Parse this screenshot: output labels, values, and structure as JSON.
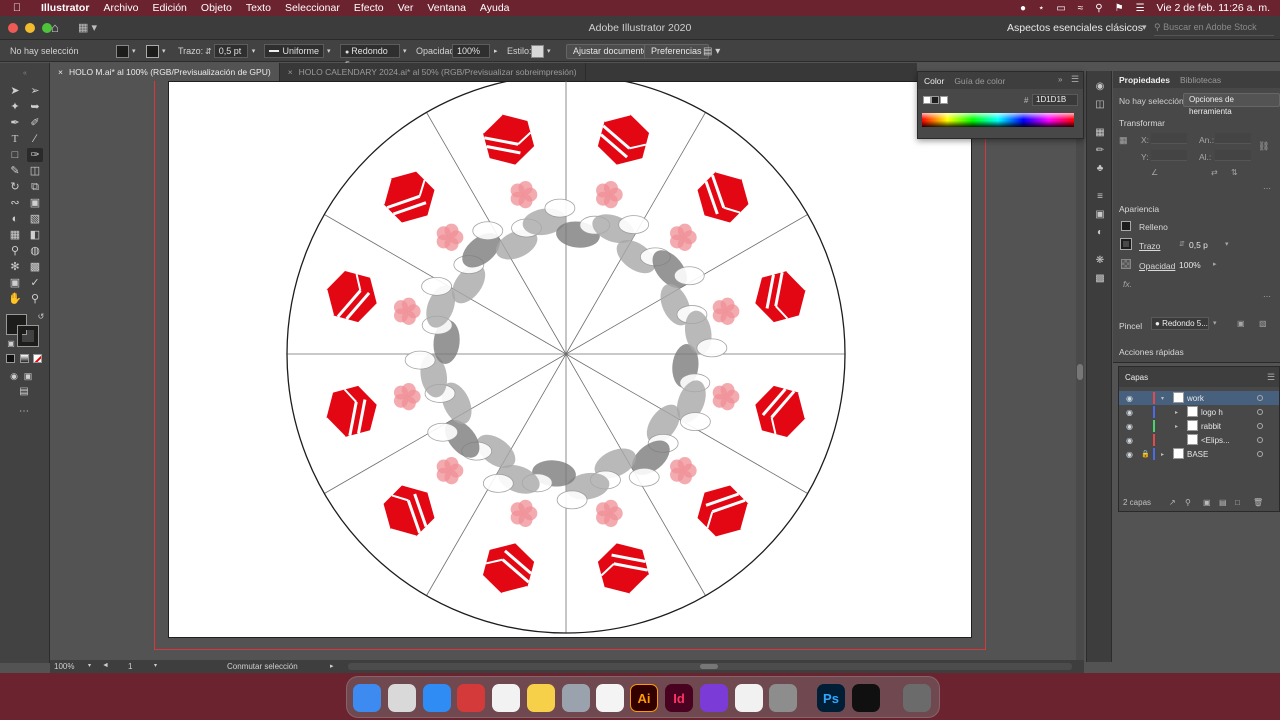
{
  "menubar": {
    "app_name": "Illustrator",
    "items": [
      "Archivo",
      "Edición",
      "Objeto",
      "Texto",
      "Seleccionar",
      "Efecto",
      "Ver",
      "Ventana",
      "Ayuda"
    ],
    "datetime": "Vie 2 de feb.  11:26 a. m."
  },
  "window": {
    "title": "Adobe Illustrator 2020",
    "workspace": "Aspectos esenciales clásicos",
    "stock_search_placeholder": "Buscar en Adobe Stock"
  },
  "control_bar": {
    "selection_status": "No hay selección",
    "stroke_label": "Trazo:",
    "stroke_weight": "0,5 pt",
    "stroke_profile": "Uniforme",
    "brush": "Redondo 5...",
    "opacity_label": "Opacidad:",
    "opacity_value": "100%",
    "style_label": "Estilo:",
    "doc_setup_button": "Ajustar documento",
    "preferences_button": "Preferencias"
  },
  "tabs": [
    {
      "label": "HOLO M.ai* al 100% (RGB/Previsualización de GPU)",
      "active": true
    },
    {
      "label": "HOLO CALENDARY 2024.ai* al 50% (RGB/Previsualizar sobreimpresión)",
      "active": false
    }
  ],
  "color_panel": {
    "tab_color": "Color",
    "tab_guide": "Guía de color",
    "hex_prefix": "#",
    "hex_value": "1D1D1B"
  },
  "properties_panel": {
    "tab_properties": "Propiedades",
    "tab_libraries": "Bibliotecas",
    "no_selection": "No hay selección",
    "tool_options_button": "Opciones de herramienta",
    "transform_title": "Transformar",
    "x_label": "X:",
    "y_label": "Y:",
    "w_label": "An.:",
    "h_label": "Al.:",
    "appearance_title": "Apariencia",
    "fill_label": "Relleno",
    "stroke_label": "Trazo",
    "stroke_value": "0,5 p",
    "opacity_label": "Opacidad",
    "opacity_value": "100%",
    "fx_label": "fx.",
    "brush_label": "Pincel",
    "brush_value": "Redondo 5...",
    "quick_actions": "Acciones rápidas"
  },
  "layers_panel": {
    "title": "Capas",
    "layers": [
      {
        "name": "work",
        "color": "#e34b4b",
        "selected": true,
        "indent": 0
      },
      {
        "name": "logo h",
        "color": "#4b6be3",
        "selected": false,
        "indent": 1
      },
      {
        "name": "rabbit",
        "color": "#4bd36b",
        "selected": false,
        "indent": 1
      },
      {
        "name": "<Elips...",
        "color": "#e34b4b",
        "selected": false,
        "indent": 1
      },
      {
        "name": "BASE",
        "color": "#4b6be3",
        "selected": false,
        "indent": 0
      }
    ],
    "count": "2 capas"
  },
  "status_bar": {
    "zoom": "100%",
    "artboard": "1",
    "tool_status": "Conmutar selección"
  },
  "colors": {
    "accent_red": "#e30613",
    "fill_color": "#1D1D1B",
    "menubar_bg": "#6b2330"
  },
  "dock": {
    "apps": [
      {
        "name": "finder-icon",
        "label": "",
        "bg": "#3d8bf0"
      },
      {
        "name": "launchpad-icon",
        "label": "",
        "bg": "#d9d9d9"
      },
      {
        "name": "app-store-icon",
        "label": "",
        "bg": "#2f8cf5"
      },
      {
        "name": "photo-booth-icon",
        "label": "",
        "bg": "#d43a3a"
      },
      {
        "name": "photos-icon",
        "label": "",
        "bg": "#f2f2f2"
      },
      {
        "name": "notes-icon",
        "label": "",
        "bg": "#f7d04a"
      },
      {
        "name": "quicktime-icon",
        "label": "",
        "bg": "#9aa3ad"
      },
      {
        "name": "chrome-icon",
        "label": "",
        "bg": "#f4f4f4"
      },
      {
        "name": "illustrator-icon",
        "label": "Ai",
        "bg": "#330000"
      },
      {
        "name": "indesign-icon",
        "label": "Id",
        "bg": "#49021f"
      },
      {
        "name": "firefox-icon",
        "label": "",
        "bg": "#7b3bd6"
      },
      {
        "name": "brave-icon",
        "label": "",
        "bg": "#f1f1f1"
      },
      {
        "name": "system-settings-icon",
        "label": "",
        "bg": "#8d8d8d"
      },
      {
        "name": "photoshop-icon",
        "label": "Ps",
        "bg": "#001e36"
      },
      {
        "name": "chatgpt-icon",
        "label": "",
        "bg": "#101010"
      },
      {
        "name": "trash-icon",
        "label": "",
        "bg": "#6b6b6b"
      }
    ]
  }
}
